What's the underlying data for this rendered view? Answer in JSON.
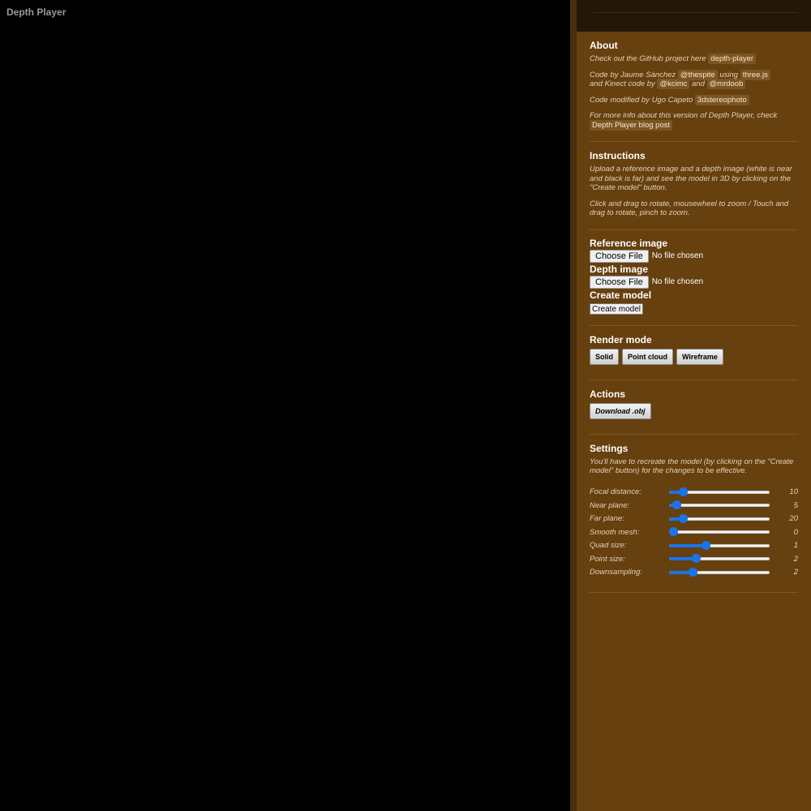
{
  "app_title": "Depth Player",
  "about": {
    "heading": "About",
    "line1_text": "Check out the GitHub project here",
    "line1_link": "depth-player",
    "line2_text_a": "Code by Jaume Sánchez",
    "line2_link_a": "@thespite",
    "line2_text_b": "using",
    "line2_link_b": "three.js",
    "line2_text_c": "and Kinect code by",
    "line2_link_c": "@kcimc",
    "line2_text_d": "and",
    "line2_link_d": "@mrdoob",
    "line3_text": "Code modified by Ugo Capeto",
    "line3_link": "3dstereophoto",
    "line4_text": "For more info about this version of Depth Player, check",
    "line4_link": "Depth Player blog post"
  },
  "instructions": {
    "heading": "Instructions",
    "p1": "Upload a reference image and a depth image (white is near and black is far) and see the model in 3D by clicking on the \"Create model\" button.",
    "p2": "Click and drag to rotate, mousewheel to zoom / Touch and drag to rotate, pinch to zoom."
  },
  "inputs": {
    "reference_label": "Reference image",
    "depth_label": "Depth image",
    "choose_file": "Choose File",
    "no_file": "No file chosen",
    "create_label": "Create model",
    "create_button": "Create model"
  },
  "render_mode": {
    "heading": "Render mode",
    "buttons": [
      "Solid",
      "Point cloud",
      "Wireframe"
    ]
  },
  "actions": {
    "heading": "Actions",
    "download": "Download .obj"
  },
  "settings": {
    "heading": "Settings",
    "note": "You'll have to recreate the model (by clicking on the \"Create model\" button) for the changes to be effective.",
    "items": [
      {
        "label": "Focal distance:",
        "value": "10",
        "fraction": 0.14
      },
      {
        "label": "Near plane:",
        "value": "5",
        "fraction": 0.07
      },
      {
        "label": "Far plane:",
        "value": "20",
        "fraction": 0.14
      },
      {
        "label": "Smooth mesh:",
        "value": "0",
        "fraction": 0.0
      },
      {
        "label": "Quad size:",
        "value": "1",
        "fraction": 0.36
      },
      {
        "label": "Point size:",
        "value": "2",
        "fraction": 0.27
      },
      {
        "label": "Downsampling:",
        "value": "2",
        "fraction": 0.23
      }
    ]
  },
  "colors": {
    "panel": "#67400f",
    "accent": "#1a73e8"
  }
}
